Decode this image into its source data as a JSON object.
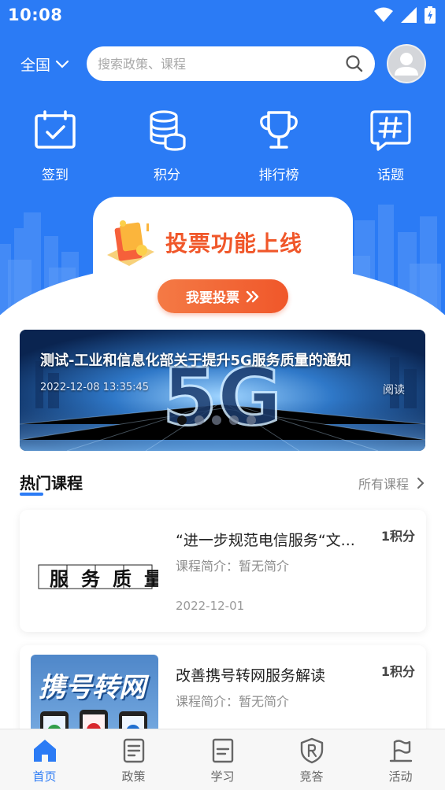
{
  "status_bar": {
    "time": "10:08"
  },
  "header": {
    "region": "全国",
    "search_placeholder": "搜索政策、课程"
  },
  "quick_actions": [
    {
      "label": "签到",
      "icon": "calendar-check-icon"
    },
    {
      "label": "积分",
      "icon": "coins-stack-icon"
    },
    {
      "label": "排行榜",
      "icon": "trophy-icon"
    },
    {
      "label": "话题",
      "icon": "hashtag-icon"
    }
  ],
  "vote_card": {
    "title": "投票功能上线",
    "button": "我要投票"
  },
  "banner": {
    "title": "测试-工业和信息化部关于提升5G服务质量的通知",
    "date": "2022-12-08 13:35:45",
    "action": "阅读",
    "slide_count": 5,
    "active_slide": 1
  },
  "hot_courses": {
    "title": "热门课程",
    "more": "所有课程",
    "items": [
      {
        "title": "“进一步规范电信服务“文...",
        "points": "1积分",
        "desc": "课程简介：暂无简介",
        "date": "2022-12-01",
        "thumb_text": "服务质量"
      },
      {
        "title": "改善携号转网服务解读",
        "points": "1积分",
        "desc": "课程简介：暂无简介",
        "date": "",
        "thumb_text": "携号转网"
      }
    ]
  },
  "bottom_nav": [
    {
      "label": "首页",
      "icon": "home-icon",
      "active": true
    },
    {
      "label": "政策",
      "icon": "document-icon",
      "active": false
    },
    {
      "label": "学习",
      "icon": "notebook-icon",
      "active": false
    },
    {
      "label": "竞答",
      "icon": "shield-quiz-icon",
      "active": false
    },
    {
      "label": "活动",
      "icon": "flag-icon",
      "active": false
    }
  ],
  "colors": {
    "primary": "#2b7bf5",
    "accent_orange": "#f0572a",
    "text_gray": "#8d8d8d"
  }
}
